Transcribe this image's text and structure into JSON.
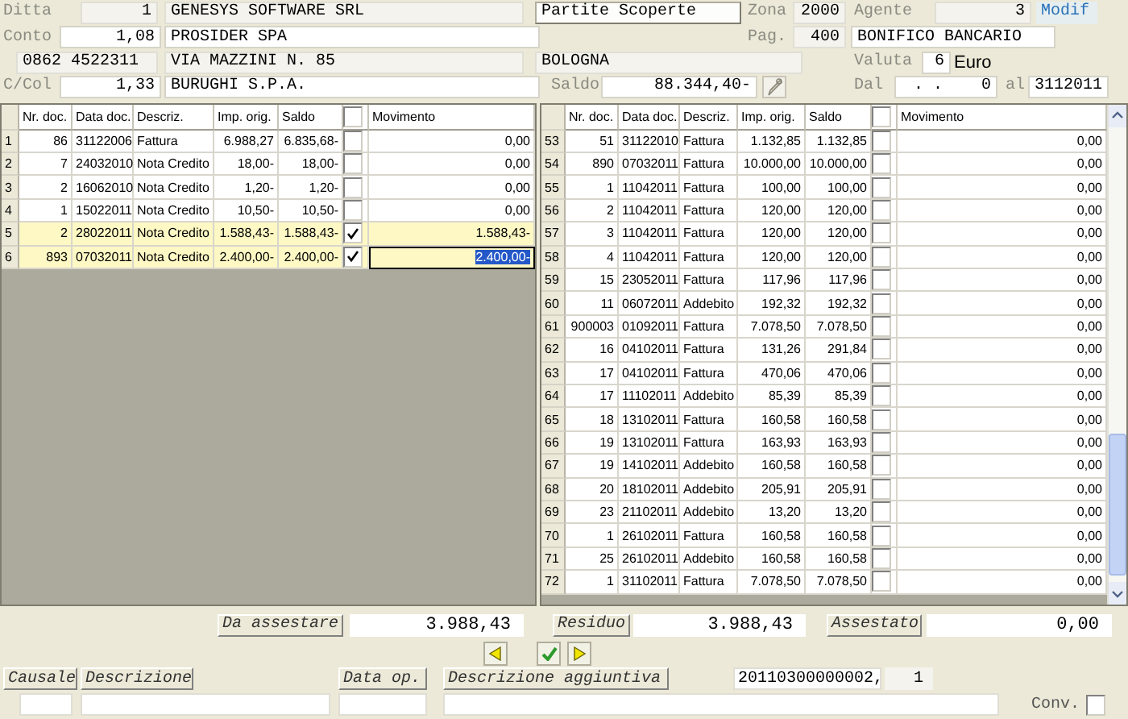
{
  "header_rows": [
    [
      {
        "kind": "label",
        "text": "Ditta"
      },
      {
        "kind": "field",
        "value": "1",
        "readonly": true
      },
      {
        "kind": "field",
        "value": "GENESYS SOFTWARE SRL",
        "readonly": true
      },
      {
        "kind": "button",
        "text": "Partite Scoperte"
      },
      {
        "kind": "label",
        "text": "Zona"
      },
      {
        "kind": "field",
        "value": "2000",
        "readonly": true
      },
      {
        "kind": "label",
        "text": "Agente"
      },
      {
        "kind": "field",
        "value": "3",
        "readonly": true
      },
      {
        "kind": "link",
        "text": "Modif"
      }
    ],
    [
      {
        "kind": "label",
        "text": "Conto"
      },
      {
        "kind": "field",
        "value": "1,08",
        "readonly": false
      },
      {
        "kind": "field",
        "value": "PROSIDER SPA",
        "readonly": false
      },
      {
        "kind": "label",
        "text": "Pag."
      },
      {
        "kind": "field",
        "value": "400",
        "readonly": true
      },
      {
        "kind": "field",
        "value": "BONIFICO BANCARIO",
        "readonly": false
      }
    ],
    [
      {
        "kind": "field",
        "value": "0862 4522311",
        "readonly": true
      },
      {
        "kind": "field",
        "value": "VIA MAZZINI N. 85",
        "readonly": true
      },
      {
        "kind": "field",
        "value": "BOLOGNA",
        "readonly": true
      },
      {
        "kind": "label",
        "text": "Valuta"
      },
      {
        "kind": "field",
        "value": "6",
        "readonly": false
      },
      {
        "kind": "text",
        "text": "Euro"
      }
    ],
    [
      {
        "kind": "label",
        "text": "C/Col"
      },
      {
        "kind": "field",
        "value": "1,33",
        "readonly": false
      },
      {
        "kind": "field",
        "value": "BURUGHI S.P.A.",
        "readonly": false
      },
      {
        "kind": "label",
        "text": "Saldo"
      },
      {
        "kind": "field",
        "value": "88.344,40-",
        "readonly": false
      },
      {
        "kind": "iconbutton"
      },
      {
        "kind": "label",
        "text": "Dal"
      },
      {
        "kind": "field",
        "value": ". .    0",
        "readonly": false
      },
      {
        "kind": "label",
        "text": "al"
      },
      {
        "kind": "field",
        "value": "3112011",
        "readonly": false
      }
    ]
  ],
  "grids": [
    {
      "columns": [
        "Nr. doc.",
        "Data doc.",
        "Descriz.",
        "Imp. orig.",
        "Saldo",
        "Movimento"
      ],
      "all_checked": false,
      "rows": [
        {
          "num": "1",
          "nr": "86",
          "date": "31122006",
          "desc": "Fattura",
          "imp": "6.988,27",
          "saldo": "6.835,68-",
          "checked": false,
          "mov": "0,00",
          "selected": false,
          "editing": false
        },
        {
          "num": "2",
          "nr": "7",
          "date": "24032010",
          "desc": "Nota Credito",
          "imp": "18,00-",
          "saldo": "18,00-",
          "checked": false,
          "mov": "0,00",
          "selected": false,
          "editing": false
        },
        {
          "num": "3",
          "nr": "2",
          "date": "16062010",
          "desc": "Nota Credito",
          "imp": "1,20-",
          "saldo": "1,20-",
          "checked": false,
          "mov": "0,00",
          "selected": false,
          "editing": false
        },
        {
          "num": "4",
          "nr": "1",
          "date": "15022011",
          "desc": "Nota Credito",
          "imp": "10,50-",
          "saldo": "10,50-",
          "checked": false,
          "mov": "0,00",
          "selected": false,
          "editing": false
        },
        {
          "num": "5",
          "nr": "2",
          "date": "28022011",
          "desc": "Nota Credito",
          "imp": "1.588,43-",
          "saldo": "1.588,43-",
          "checked": true,
          "mov": "1.588,43-",
          "selected": true,
          "editing": false
        },
        {
          "num": "6",
          "nr": "893",
          "date": "07032011",
          "desc": "Nota Credito",
          "imp": "2.400,00-",
          "saldo": "2.400,00-",
          "checked": true,
          "mov": "2.400,00-",
          "selected": true,
          "editing": true
        }
      ]
    },
    {
      "columns": [
        "Nr. doc.",
        "Data doc.",
        "Descriz.",
        "Imp. orig.",
        "Saldo",
        "Movimento"
      ],
      "all_checked": false,
      "rows": [
        {
          "num": "53",
          "nr": "51",
          "date": "31122010",
          "desc": "Fattura",
          "imp": "1.132,85",
          "saldo": "1.132,85",
          "checked": false,
          "mov": "0,00"
        },
        {
          "num": "54",
          "nr": "890",
          "date": "07032011",
          "desc": "Fattura",
          "imp": "10.000,00",
          "saldo": "10.000,00",
          "checked": false,
          "mov": "0,00"
        },
        {
          "num": "55",
          "nr": "1",
          "date": "11042011",
          "desc": "Fattura",
          "imp": "100,00",
          "saldo": "100,00",
          "checked": false,
          "mov": "0,00"
        },
        {
          "num": "56",
          "nr": "2",
          "date": "11042011",
          "desc": "Fattura",
          "imp": "120,00",
          "saldo": "120,00",
          "checked": false,
          "mov": "0,00"
        },
        {
          "num": "57",
          "nr": "3",
          "date": "11042011",
          "desc": "Fattura",
          "imp": "120,00",
          "saldo": "120,00",
          "checked": false,
          "mov": "0,00"
        },
        {
          "num": "58",
          "nr": "4",
          "date": "11042011",
          "desc": "Fattura",
          "imp": "120,00",
          "saldo": "120,00",
          "checked": false,
          "mov": "0,00"
        },
        {
          "num": "59",
          "nr": "15",
          "date": "23052011",
          "desc": "Fattura",
          "imp": "117,96",
          "saldo": "117,96",
          "checked": false,
          "mov": "0,00"
        },
        {
          "num": "60",
          "nr": "11",
          "date": "06072011",
          "desc": "Addebito",
          "imp": "192,32",
          "saldo": "192,32",
          "checked": false,
          "mov": "0,00"
        },
        {
          "num": "61",
          "nr": "900003",
          "date": "01092011",
          "desc": "Fattura",
          "imp": "7.078,50",
          "saldo": "7.078,50",
          "checked": false,
          "mov": "0,00"
        },
        {
          "num": "62",
          "nr": "16",
          "date": "04102011",
          "desc": "Fattura",
          "imp": "131,26",
          "saldo": "291,84",
          "checked": false,
          "mov": "0,00"
        },
        {
          "num": "63",
          "nr": "17",
          "date": "04102011",
          "desc": "Fattura",
          "imp": "470,06",
          "saldo": "470,06",
          "checked": false,
          "mov": "0,00"
        },
        {
          "num": "64",
          "nr": "17",
          "date": "11102011",
          "desc": "Addebito",
          "imp": "85,39",
          "saldo": "85,39",
          "checked": false,
          "mov": "0,00"
        },
        {
          "num": "65",
          "nr": "18",
          "date": "13102011",
          "desc": "Fattura",
          "imp": "160,58",
          "saldo": "160,58",
          "checked": false,
          "mov": "0,00"
        },
        {
          "num": "66",
          "nr": "19",
          "date": "13102011",
          "desc": "Fattura",
          "imp": "163,93",
          "saldo": "163,93",
          "checked": false,
          "mov": "0,00"
        },
        {
          "num": "67",
          "nr": "19",
          "date": "14102011",
          "desc": "Addebito",
          "imp": "160,58",
          "saldo": "160,58",
          "checked": false,
          "mov": "0,00"
        },
        {
          "num": "68",
          "nr": "20",
          "date": "18102011",
          "desc": "Addebito",
          "imp": "205,91",
          "saldo": "205,91",
          "checked": false,
          "mov": "0,00"
        },
        {
          "num": "69",
          "nr": "23",
          "date": "21102011",
          "desc": "Addebito",
          "imp": "13,20",
          "saldo": "13,20",
          "checked": false,
          "mov": "0,00"
        },
        {
          "num": "70",
          "nr": "1",
          "date": "26102011",
          "desc": "Fattura",
          "imp": "160,58",
          "saldo": "160,58",
          "checked": false,
          "mov": "0,00"
        },
        {
          "num": "71",
          "nr": "25",
          "date": "26102011",
          "desc": "Addebito",
          "imp": "160,58",
          "saldo": "160,58",
          "checked": false,
          "mov": "0,00"
        },
        {
          "num": "72",
          "nr": "1",
          "date": "31102011",
          "desc": "Fattura",
          "imp": "7.078,50",
          "saldo": "7.078,50",
          "checked": false,
          "mov": "0,00"
        }
      ]
    }
  ],
  "totals": [
    {
      "label": "Da assestare",
      "value": "3.988,43"
    },
    {
      "label": "Residuo",
      "value": "3.988,43"
    },
    {
      "label": "Assestato",
      "value": "0,00"
    }
  ],
  "footer": {
    "labels": [
      "Causale",
      "Descrizione",
      "Data op.",
      "Descrizione aggiuntiva"
    ],
    "code": "20110300000002,",
    "counter": "1",
    "conv_label": "Conv.",
    "conv_checked": false
  }
}
